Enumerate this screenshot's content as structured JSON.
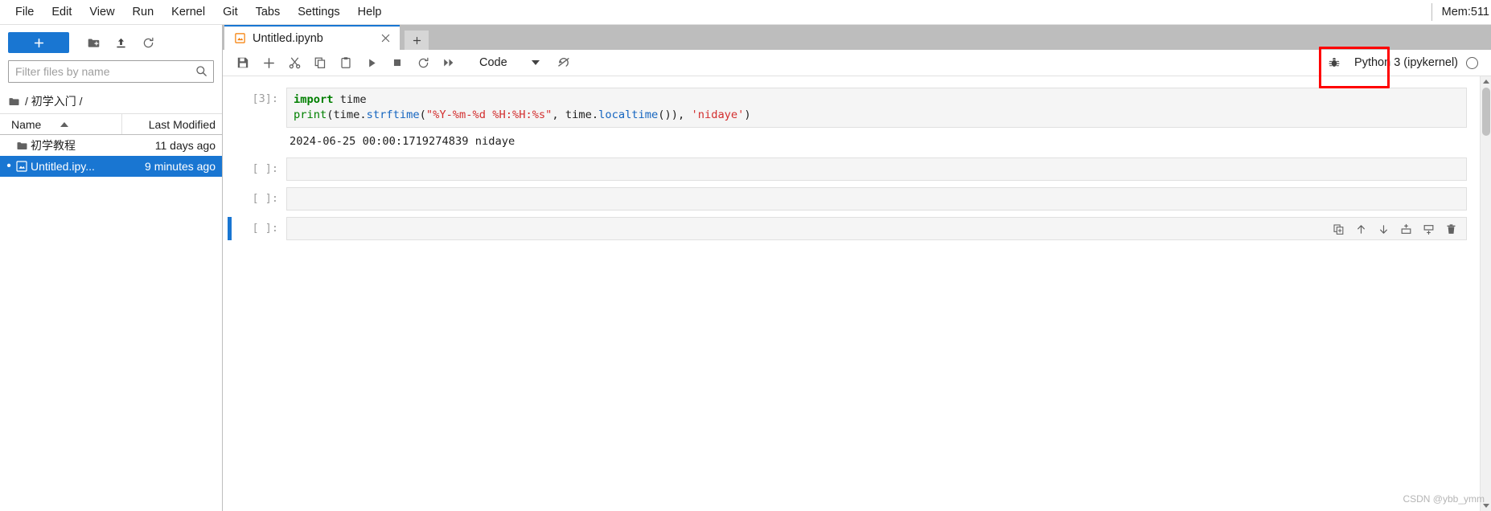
{
  "menubar": {
    "items": [
      {
        "label": "File"
      },
      {
        "label": "Edit"
      },
      {
        "label": "View"
      },
      {
        "label": "Run"
      },
      {
        "label": "Kernel"
      },
      {
        "label": "Git"
      },
      {
        "label": "Tabs"
      },
      {
        "label": "Settings"
      },
      {
        "label": "Help"
      }
    ],
    "memory_label": "Mem:511"
  },
  "filebrowser": {
    "new_launcher_label": "+",
    "toolbar_icons": [
      "new-folder-icon",
      "upload-icon",
      "refresh-icon"
    ],
    "filter_placeholder": "Filter files by name",
    "filter_value": "",
    "breadcrumb": "/ 初学入门 /",
    "columns": {
      "name": "Name",
      "last_modified": "Last Modified"
    },
    "rows": [
      {
        "name": "初学教程",
        "modified": "11 days ago",
        "type": "folder",
        "selected": false,
        "dirty": false
      },
      {
        "name": "Untitled.ipy...",
        "modified": "9 minutes ago",
        "type": "notebook",
        "selected": true,
        "dirty": true
      }
    ]
  },
  "tabbar": {
    "tabs": [
      {
        "label": "Untitled.ipynb",
        "icon": "notebook-icon",
        "active": true
      }
    ],
    "add_tab_label": "+"
  },
  "notebook_toolbar": {
    "buttons": [
      {
        "name": "save-button",
        "icon": "save-icon"
      },
      {
        "name": "insert-cell-button",
        "icon": "plus-icon"
      },
      {
        "name": "cut-cell-button",
        "icon": "scissors-icon"
      },
      {
        "name": "copy-cell-button",
        "icon": "copy-icon"
      },
      {
        "name": "paste-cell-button",
        "icon": "paste-icon"
      },
      {
        "name": "run-cell-button",
        "icon": "play-icon"
      },
      {
        "name": "interrupt-kernel-button",
        "icon": "stop-icon"
      },
      {
        "name": "restart-kernel-button",
        "icon": "restart-icon"
      },
      {
        "name": "restart-run-all-button",
        "icon": "fast-forward-icon"
      }
    ],
    "cell_type": "Code",
    "restart_run_icon": "restart-run-all-icon",
    "debugger_icon": "bug-icon",
    "kernel_name": "Python 3 (ipykernel)",
    "kernel_status": "idle"
  },
  "notebook": {
    "cells": [
      {
        "prompt": "[3]:",
        "active": false,
        "source_lines": [
          [
            {
              "t": "import",
              "c": "kw"
            },
            {
              "t": " time",
              "c": "plain"
            }
          ],
          [
            {
              "t": "print",
              "c": "fn"
            },
            {
              "t": "(time.",
              "c": "plain"
            },
            {
              "t": "strftime",
              "c": "attr"
            },
            {
              "t": "(",
              "c": "plain"
            },
            {
              "t": "\"%Y-%m-%d %H:%H:%s\"",
              "c": "str"
            },
            {
              "t": ", time.",
              "c": "plain"
            },
            {
              "t": "localtime",
              "c": "attr"
            },
            {
              "t": "()), ",
              "c": "plain"
            },
            {
              "t": "'nidaye'",
              "c": "str"
            },
            {
              "t": ")",
              "c": "plain"
            }
          ]
        ],
        "output": "2024-06-25 00:00:1719274839 nidaye"
      },
      {
        "prompt": "[ ]:",
        "active": false,
        "source_lines": [],
        "output": null
      },
      {
        "prompt": "[ ]:",
        "active": false,
        "source_lines": [],
        "output": null
      },
      {
        "prompt": "[ ]:",
        "active": true,
        "source_lines": [],
        "output": null
      }
    ],
    "cell_toolbar_buttons": [
      {
        "name": "duplicate-cell-button",
        "icon": "duplicate-icon"
      },
      {
        "name": "move-cell-up-button",
        "icon": "arrow-up-icon"
      },
      {
        "name": "move-cell-down-button",
        "icon": "arrow-down-icon"
      },
      {
        "name": "insert-cell-above-button",
        "icon": "insert-above-icon"
      },
      {
        "name": "insert-cell-below-button",
        "icon": "insert-below-icon"
      },
      {
        "name": "delete-cell-button",
        "icon": "trash-icon"
      }
    ]
  },
  "annotation": {
    "color": "#ff0000",
    "target": "Python 3"
  },
  "watermark": "CSDN @ybb_ymm"
}
